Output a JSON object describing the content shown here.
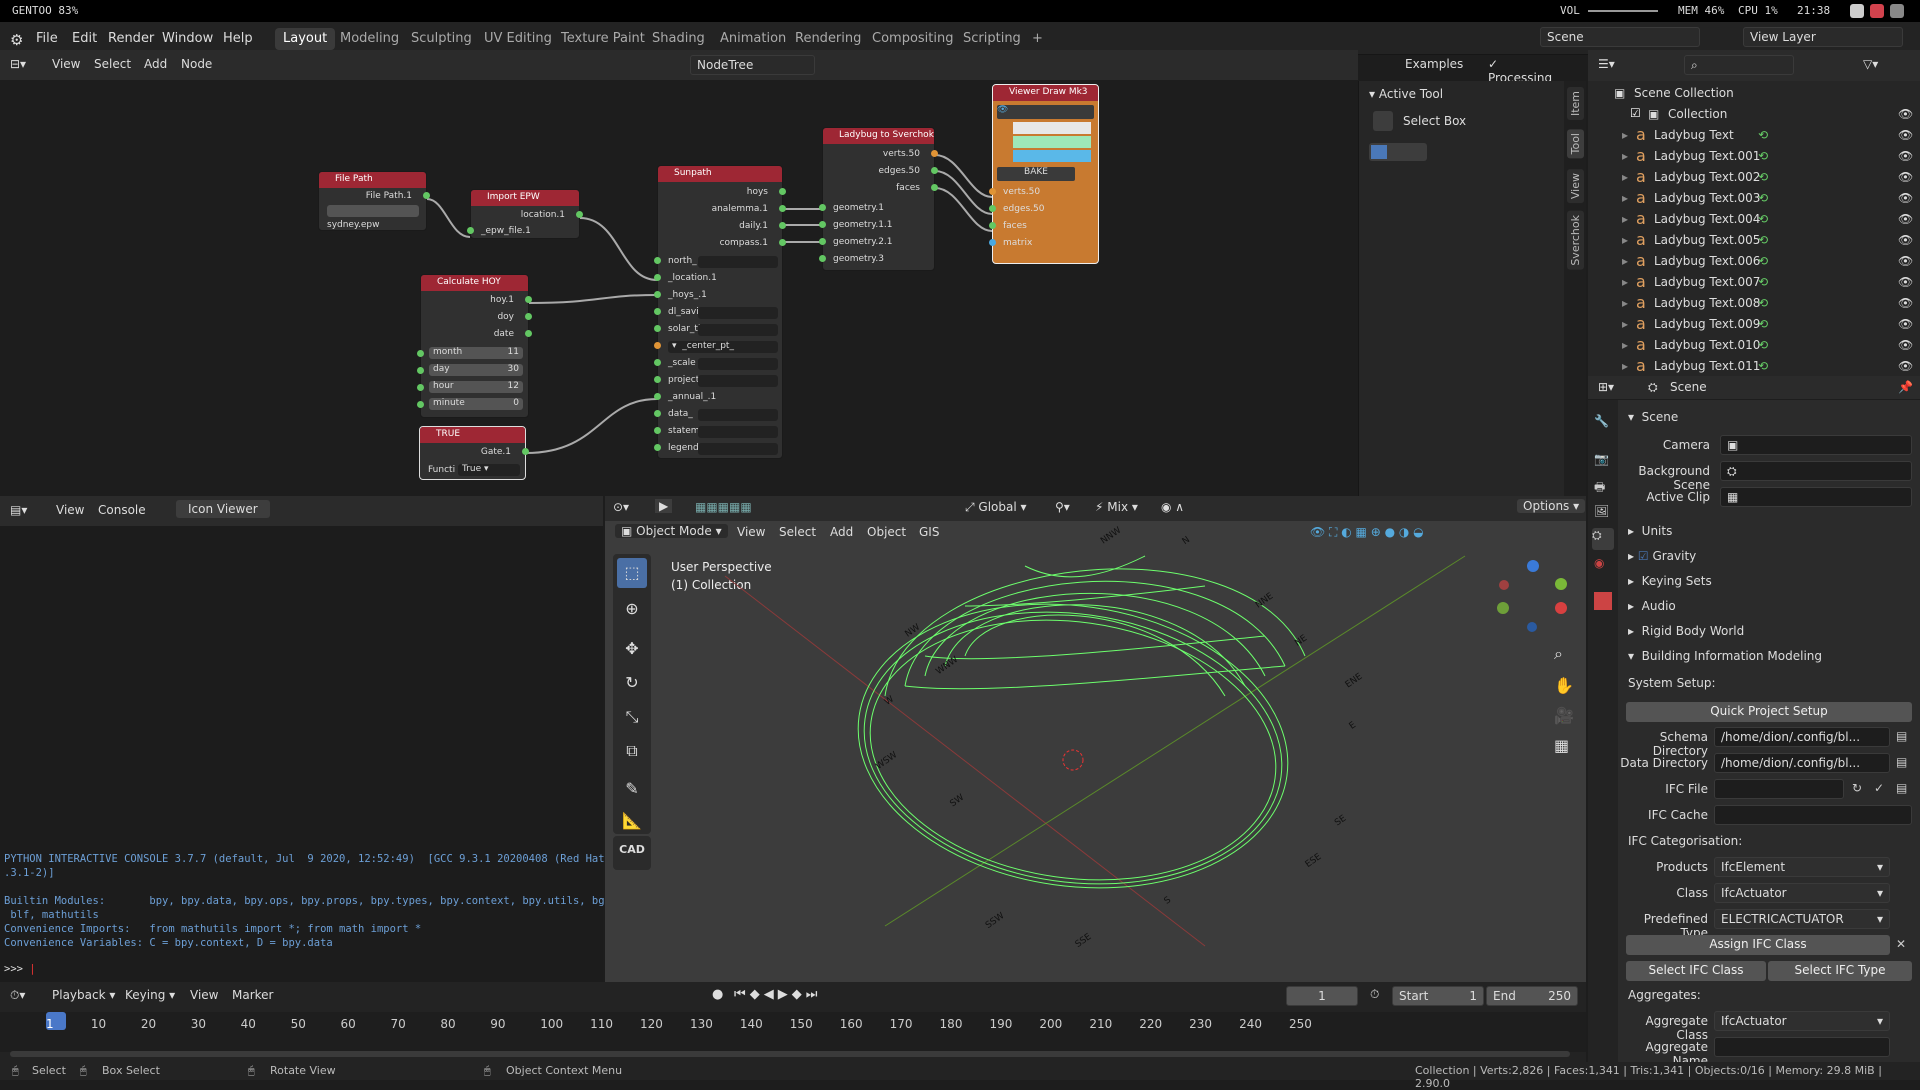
{
  "topbar": {
    "left": "GENTOO 83%",
    "vol": "VOL",
    "mem": "MEM 46%",
    "cpu": "CPU 1%",
    "time": "21:38"
  },
  "menu": {
    "items": [
      "File",
      "Edit",
      "Render",
      "Window",
      "Help"
    ],
    "workspaces": [
      "Layout",
      "Modeling",
      "Sculpting",
      "UV Editing",
      "Texture Paint",
      "Shading",
      "Animation",
      "Rendering",
      "Compositing",
      "Scripting"
    ],
    "active_ws": "Layout",
    "add": "+",
    "scene": "Scene",
    "view_layer": "View Layer"
  },
  "node_editor": {
    "menu": [
      "View",
      "Select",
      "Add",
      "Node"
    ],
    "tree_name": "NodeTree",
    "examples": "Examples",
    "processing": "Processing"
  },
  "nodes": {
    "file_path": {
      "title": "File Path",
      "out": "File Path.1",
      "value": "sydney.epw"
    },
    "import_epw": {
      "title": "Import EPW",
      "out": "location.1",
      "in": "_epw_file.1"
    },
    "calc_hoy": {
      "title": "Calculate HOY",
      "outs": [
        "hoy.1",
        "doy",
        "date"
      ],
      "fields": [
        {
          "label": "month",
          "value": "11"
        },
        {
          "label": "day",
          "value": "30"
        },
        {
          "label": "hour",
          "value": "12"
        },
        {
          "label": "minute",
          "value": "0"
        }
      ]
    },
    "true_node": {
      "title": "TRUE",
      "out": "Gate.1",
      "func_label": "Functi",
      "func_value": "True"
    },
    "sunpath": {
      "title": "Sunpath",
      "outs": [
        "hoys",
        "analemma.1",
        "daily.1",
        "compass.1"
      ],
      "ins": [
        "north_",
        "_location.1",
        "_hoys_.1",
        "dl_savi",
        "solar_ti",
        "_center_pt_",
        "_scale",
        "project",
        "_annual_.1",
        "data_",
        "statem",
        "legend"
      ]
    },
    "ladybug": {
      "title": "Ladybug to Sverchok",
      "outs": [
        "verts.50",
        "edges.50",
        "faces"
      ],
      "ins": [
        "geometry.1",
        "geometry.1.1",
        "geometry.2.1",
        "geometry.3"
      ]
    },
    "viewer": {
      "title": "Viewer Draw Mk3",
      "bake": "BAKE",
      "ins": [
        "verts.50",
        "edges.50",
        "faces",
        "matrix"
      ]
    }
  },
  "side_panel": {
    "title": "Active Tool",
    "tool": "Select Box",
    "tabs": [
      "Item",
      "Tool",
      "View",
      "Sverchok"
    ]
  },
  "outliner": {
    "root": "Scene Collection",
    "collection": "Collection",
    "items": [
      "Ladybug Text",
      "Ladybug Text.001",
      "Ladybug Text.002",
      "Ladybug Text.003",
      "Ladybug Text.004",
      "Ladybug Text.005",
      "Ladybug Text.006",
      "Ladybug Text.007",
      "Ladybug Text.008",
      "Ladybug Text.009",
      "Ladybug Text.010",
      "Ladybug Text.011"
    ]
  },
  "props": {
    "header": "Scene",
    "section": "Scene",
    "camera": "Camera",
    "bg_scene": "Background Scene",
    "active_clip": "Active Clip",
    "units": "Units",
    "gravity": "Gravity",
    "keying": "Keying Sets",
    "audio": "Audio",
    "rigid": "Rigid Body World",
    "bim": "Building Information Modeling",
    "system_setup": "System Setup:",
    "quick_setup": "Quick Project Setup",
    "schema_dir": "Schema Directory",
    "schema_val": "/home/dion/.config/bl...",
    "data_dir": "Data Directory",
    "data_val": "/home/dion/.config/bl...",
    "ifc_file": "IFC File",
    "ifc_cache": "IFC Cache",
    "ifc_cat": "IFC Categorisation:",
    "products": "Products",
    "products_val": "IfcElement",
    "class": "Class",
    "class_val": "IfcActuator",
    "predef": "Predefined Type",
    "predef_val": "ELECTRICACTUATOR",
    "assign": "Assign IFC Class",
    "sel_class": "Select IFC Class",
    "sel_type": "Select IFC Type",
    "aggregates": "Aggregates:",
    "agg_class": "Aggregate Class",
    "agg_class_val": "IfcActuator",
    "agg_name": "Aggregate Name"
  },
  "console": {
    "menu": [
      "View",
      "Console"
    ],
    "tab": "Icon Viewer",
    "lines": [
      "PYTHON INTERACTIVE CONSOLE 3.7.7 (default, Jul  9 2020, 12:52:49)  [GCC 9.3.1 20200408 (Red Hat 9",
      ".3.1-2)]",
      "",
      "Builtin Modules:       bpy, bpy.data, bpy.ops, bpy.props, bpy.types, bpy.context, bpy.utils, bgl,",
      " blf, mathutils",
      "Convenience Imports:   from mathutils import *; from math import *",
      "Convenience Variables: C = bpy.context, D = bpy.data"
    ],
    "prompt": ">>> "
  },
  "viewport": {
    "mode": "Object Mode",
    "menu": [
      "View",
      "Select",
      "Add",
      "Object",
      "GIS"
    ],
    "orientation": "Global",
    "pivot": "Mix",
    "options": "Options",
    "info1": "User Perspective",
    "info2": "(1) Collection",
    "cad": "CAD",
    "compass": [
      "N",
      "NE",
      "E",
      "SE",
      "S",
      "SW",
      "W",
      "NW",
      "NNE",
      "ENE",
      "ESE",
      "SSE",
      "SSW",
      "WSW",
      "WNW",
      "NNW"
    ]
  },
  "timeline": {
    "menu": [
      "Playback",
      "Keying",
      "View",
      "Marker"
    ],
    "frame": "1",
    "start_label": "Start",
    "start": "1",
    "end_label": "End",
    "end": "250",
    "ticks": [
      "1",
      "10",
      "20",
      "30",
      "40",
      "50",
      "60",
      "70",
      "80",
      "90",
      "100",
      "110",
      "120",
      "130",
      "140",
      "150",
      "160",
      "170",
      "180",
      "190",
      "200",
      "210",
      "220",
      "230",
      "240",
      "250"
    ]
  },
  "status": {
    "select": "Select",
    "box_select": "Box Select",
    "rotate": "Rotate View",
    "context": "Object Context Menu",
    "stats": "Collection | Verts:2,826 | Faces:1,341 | Tris:1,341 | Objects:0/16 | Memory: 29.8 MiB | 2.90.0"
  }
}
